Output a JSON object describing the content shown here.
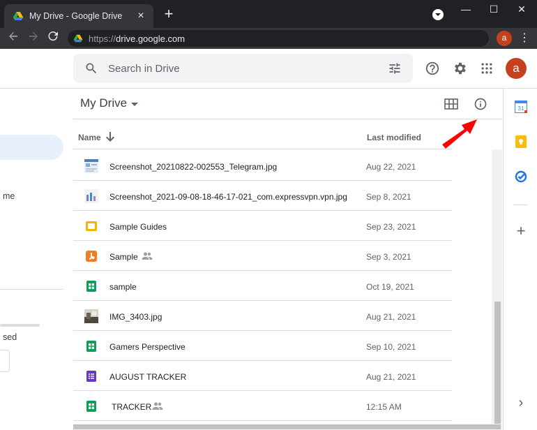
{
  "browser": {
    "tab_title": "My Drive - Google Drive",
    "tab_close": "×",
    "new_tab": "+",
    "url_scheme": "https://",
    "url_host": "drive.google.com",
    "profile_letter": "a",
    "menu_glyph": "⋮",
    "window_controls": [
      "—",
      "☐",
      "✕"
    ]
  },
  "header": {
    "search_placeholder": "Search in Drive",
    "avatar_letter": "a",
    "colors": {
      "avatar": "#c5411e",
      "search_bg": "#f1f3f4"
    }
  },
  "sidebar": {
    "partial_texts": [
      "me",
      "sed"
    ]
  },
  "main": {
    "title": "My Drive",
    "columns": {
      "name": "Name",
      "modified": "Last modified"
    }
  },
  "files": [
    {
      "name": "Screenshot_20210822-002553_Telegram.jpg",
      "modified": "Aug 22, 2021",
      "icon": "image-thumb-icon",
      "shared": false
    },
    {
      "name": "Screenshot_2021-09-08-18-46-17-021_com.expressvpn.vpn.jpg",
      "modified": "Sep 8, 2021",
      "icon": "image-thumb-icon",
      "shared": false
    },
    {
      "name": "Sample Guides",
      "modified": "Sep 23, 2021",
      "icon": "slides-icon",
      "shared": false
    },
    {
      "name": "Sample",
      "modified": "Sep 3, 2021",
      "icon": "jamboard-icon",
      "shared": true
    },
    {
      "name": "sample",
      "modified": "Oct 19, 2021",
      "icon": "sheets-icon",
      "shared": false
    },
    {
      "name": "IMG_3403.jpg",
      "modified": "Aug 21, 2021",
      "icon": "photo-thumb-icon",
      "shared": false
    },
    {
      "name": "Gamers Perspective",
      "modified": "Sep 10, 2021",
      "icon": "sheets-icon",
      "shared": false
    },
    {
      "name": "AUGUST TRACKER",
      "modified": "Aug 21, 2021",
      "icon": "forms-icon",
      "shared": false
    },
    {
      "name": "TRACKER",
      "modified": "12:15 AM",
      "icon": "sheets-icon",
      "shared": true
    }
  ],
  "right_rail": {
    "calendar_day": "31",
    "add": "+",
    "expand": "›"
  }
}
